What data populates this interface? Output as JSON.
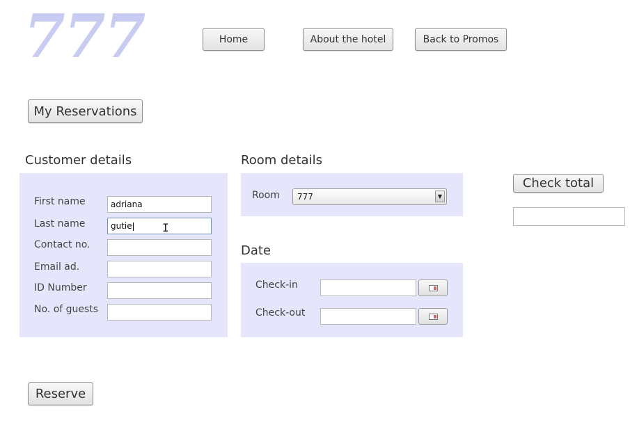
{
  "logo": {
    "text": "777"
  },
  "nav": {
    "home_label": "Home",
    "about_label": "About the hotel",
    "promos_label": "Back to Promos"
  },
  "my_reservations_label": "My Reservations",
  "customer": {
    "title": "Customer details",
    "fields": [
      {
        "label": "First name",
        "value": "adriana"
      },
      {
        "label": "Last name",
        "value": "gutie"
      },
      {
        "label": "Contact no.",
        "value": ""
      },
      {
        "label": "Email ad.",
        "value": ""
      },
      {
        "label": "ID Number",
        "value": ""
      },
      {
        "label": "No. of guests",
        "value": ""
      }
    ]
  },
  "room": {
    "title": "Room details",
    "room_label": "Room",
    "room_selected": "777"
  },
  "date": {
    "title": "Date",
    "checkin_label": "Check-in",
    "checkout_label": "Check-out",
    "checkin_value": "",
    "checkout_value": ""
  },
  "check_total_label": "Check total",
  "total_value": "",
  "reserve_label": "Reserve",
  "colors": {
    "panel_bg": "#e5e6fb",
    "logo": "#c9ccf2"
  }
}
